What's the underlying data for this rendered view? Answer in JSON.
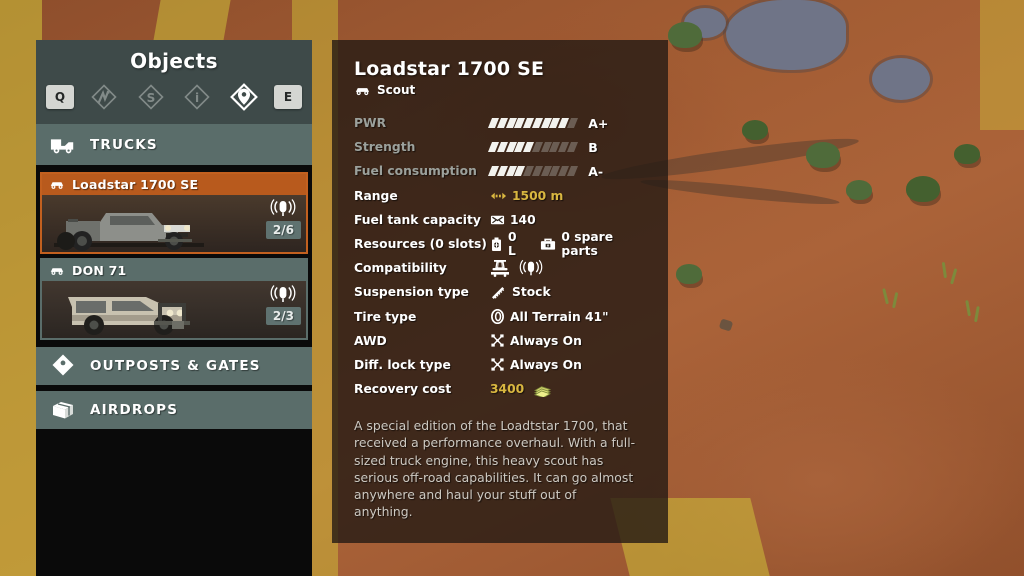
{
  "sidebar": {
    "title": "Objects",
    "prev_key": "Q",
    "next_key": "E",
    "tabs": [
      {
        "name": "tab-routes",
        "icon": "road-diamond-icon",
        "active": false
      },
      {
        "name": "tab-shop",
        "icon": "dollar-diamond-icon",
        "active": false
      },
      {
        "name": "tab-info",
        "icon": "info-diamond-icon",
        "active": false
      },
      {
        "name": "tab-objects",
        "icon": "map-pin-diamond-icon",
        "active": true
      }
    ],
    "sections": [
      {
        "label": "TRUCKS",
        "icon": "truck-icon"
      },
      {
        "label": "OUTPOSTS & GATES",
        "icon": "map-pin-icon"
      },
      {
        "label": "AIRDROPS",
        "icon": "crate-icon"
      }
    ],
    "trucks": [
      {
        "name": "Loadstar 1700 SE",
        "badge": "2/6",
        "selected": true,
        "signal_icon": "radio-signal-icon",
        "type_icon": "scout-car-icon"
      },
      {
        "name": "DON 71",
        "badge": "2/3",
        "selected": false,
        "signal_icon": "radio-signal-icon",
        "type_icon": "scout-car-icon"
      }
    ]
  },
  "detail": {
    "title": "Loadstar 1700 SE",
    "class": "Scout",
    "class_icon": "scout-car-icon",
    "stats": [
      {
        "label": "PWR",
        "kind": "bar",
        "filled": 9,
        "total": 10,
        "grade": "A+",
        "dim": true
      },
      {
        "label": "Strength",
        "kind": "bar",
        "filled": 5,
        "total": 10,
        "grade": "B",
        "dim": true
      },
      {
        "label": "Fuel consumption",
        "kind": "bar",
        "filled": 4,
        "total": 10,
        "grade": "A-",
        "dim": true
      },
      {
        "label": "Range",
        "kind": "value",
        "icon": "range-icon",
        "value": "1500 m",
        "gold": true
      },
      {
        "label": "Fuel tank capacity",
        "kind": "value",
        "icon": "fuel-tank-icon",
        "value": "140"
      },
      {
        "label": "Resources (0 slots)",
        "kind": "value2",
        "icon": "fuel-can-icon",
        "value": "0 L",
        "icon2": "toolbox-icon",
        "value2": "0 spare parts"
      },
      {
        "label": "Compatibility",
        "kind": "icons",
        "icons": [
          "crane-icon",
          "radio-signal-icon"
        ]
      },
      {
        "label": "Suspension type",
        "kind": "value",
        "icon": "suspension-icon",
        "value": "Stock"
      },
      {
        "label": "Tire type",
        "kind": "value",
        "icon": "tire-icon",
        "value": "All Terrain 41\""
      },
      {
        "label": "AWD",
        "kind": "value",
        "icon": "awd-icon",
        "value": "Always On"
      },
      {
        "label": "Diff. lock type",
        "kind": "value",
        "icon": "difflock-icon",
        "value": "Always On"
      },
      {
        "label": "Recovery cost",
        "kind": "value-money",
        "value": "3400",
        "icon": "money-icon",
        "gold": true
      }
    ],
    "description": "A special edition of the Loadtstar 1700, that received a performance overhaul. With a full-sized truck engine, this heavy scout has serious off-road capabilities. It can go almost anywhere and haul your stuff out of anything."
  },
  "colors": {
    "accent_orange": "#b85a1d",
    "panel_green": "#5a6d6a",
    "header_green": "#3e4a49",
    "gold": "#d9b740",
    "panel_dark": "#241a14"
  }
}
